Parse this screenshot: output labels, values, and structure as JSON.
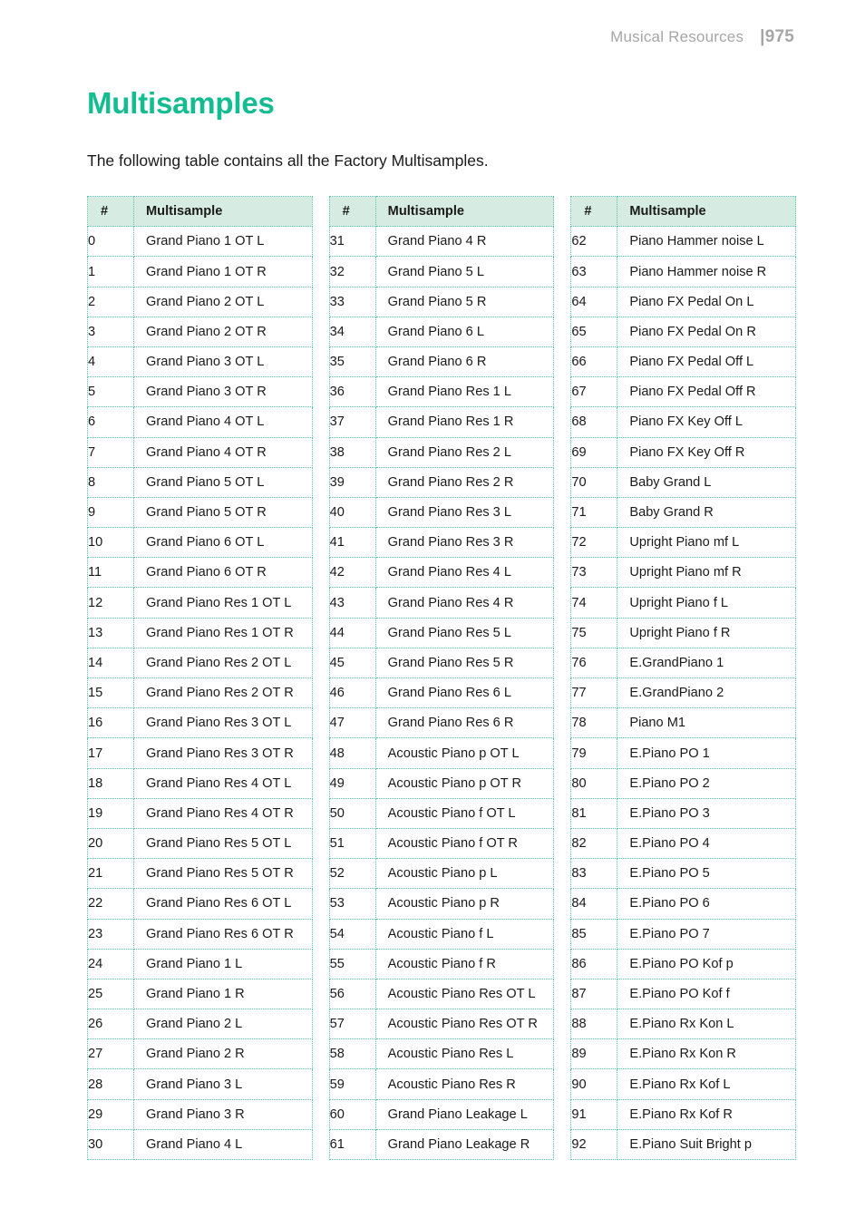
{
  "header": {
    "section_title": "Musical Resources",
    "page_number": "|975"
  },
  "page": {
    "title": "Multisamples",
    "intro": "The following table contains all the Factory Multisamples.",
    "accent_color": "#13bc91",
    "header_row_color": "#d6ece3",
    "grid_color": "#57c4ac"
  },
  "table": {
    "columns": [
      {
        "num_header": "#",
        "name_header": "Multisample"
      },
      {
        "num_header": "#",
        "name_header": "Multisample"
      },
      {
        "num_header": "#",
        "name_header": "Multisample"
      }
    ],
    "blocks": [
      {
        "rows": [
          {
            "num": "0",
            "name": "Grand Piano 1 OT L"
          },
          {
            "num": "1",
            "name": "Grand Piano 1 OT R"
          },
          {
            "num": "2",
            "name": "Grand Piano 2 OT L"
          },
          {
            "num": "3",
            "name": "Grand Piano 2 OT R"
          },
          {
            "num": "4",
            "name": "Grand Piano 3 OT L"
          },
          {
            "num": "5",
            "name": "Grand Piano 3 OT R"
          },
          {
            "num": "6",
            "name": "Grand Piano 4 OT L"
          },
          {
            "num": "7",
            "name": "Grand Piano 4 OT R"
          },
          {
            "num": "8",
            "name": "Grand Piano 5 OT L"
          },
          {
            "num": "9",
            "name": "Grand Piano 5 OT R"
          },
          {
            "num": "10",
            "name": "Grand Piano 6 OT L"
          },
          {
            "num": "11",
            "name": "Grand Piano 6 OT R"
          },
          {
            "num": "12",
            "name": "Grand Piano Res 1 OT L"
          },
          {
            "num": "13",
            "name": "Grand Piano Res 1 OT R"
          },
          {
            "num": "14",
            "name": "Grand Piano Res 2 OT L"
          },
          {
            "num": "15",
            "name": "Grand Piano Res 2 OT R"
          },
          {
            "num": "16",
            "name": "Grand Piano Res 3 OT L"
          },
          {
            "num": "17",
            "name": "Grand Piano Res 3 OT R"
          },
          {
            "num": "18",
            "name": "Grand Piano Res 4 OT L"
          },
          {
            "num": "19",
            "name": "Grand Piano Res 4 OT R"
          },
          {
            "num": "20",
            "name": "Grand Piano Res 5 OT L"
          },
          {
            "num": "21",
            "name": "Grand Piano Res 5 OT R"
          },
          {
            "num": "22",
            "name": "Grand Piano Res 6 OT L"
          },
          {
            "num": "23",
            "name": "Grand Piano Res 6 OT R"
          },
          {
            "num": "24",
            "name": "Grand Piano 1 L"
          },
          {
            "num": "25",
            "name": "Grand Piano 1 R"
          },
          {
            "num": "26",
            "name": "Grand Piano 2 L"
          },
          {
            "num": "27",
            "name": "Grand Piano 2 R"
          },
          {
            "num": "28",
            "name": "Grand Piano 3 L"
          },
          {
            "num": "29",
            "name": "Grand Piano 3 R"
          },
          {
            "num": "30",
            "name": "Grand Piano 4 L"
          }
        ]
      },
      {
        "rows": [
          {
            "num": "31",
            "name": "Grand Piano 4 R"
          },
          {
            "num": "32",
            "name": "Grand Piano 5 L"
          },
          {
            "num": "33",
            "name": "Grand Piano 5 R"
          },
          {
            "num": "34",
            "name": "Grand Piano 6 L"
          },
          {
            "num": "35",
            "name": "Grand Piano 6 R"
          },
          {
            "num": "36",
            "name": "Grand Piano Res 1 L"
          },
          {
            "num": "37",
            "name": "Grand Piano Res 1 R"
          },
          {
            "num": "38",
            "name": "Grand Piano Res 2 L"
          },
          {
            "num": "39",
            "name": "Grand Piano Res 2 R"
          },
          {
            "num": "40",
            "name": "Grand Piano Res 3 L"
          },
          {
            "num": "41",
            "name": "Grand Piano Res 3 R"
          },
          {
            "num": "42",
            "name": "Grand Piano Res 4 L"
          },
          {
            "num": "43",
            "name": "Grand Piano Res 4 R"
          },
          {
            "num": "44",
            "name": "Grand Piano Res 5 L"
          },
          {
            "num": "45",
            "name": "Grand Piano Res 5 R"
          },
          {
            "num": "46",
            "name": "Grand Piano Res 6 L"
          },
          {
            "num": "47",
            "name": "Grand Piano Res 6 R"
          },
          {
            "num": "48",
            "name": "Acoustic Piano p OT L"
          },
          {
            "num": "49",
            "name": "Acoustic Piano p OT R"
          },
          {
            "num": "50",
            "name": "Acoustic Piano f OT L"
          },
          {
            "num": "51",
            "name": "Acoustic Piano f OT R"
          },
          {
            "num": "52",
            "name": "Acoustic Piano p L"
          },
          {
            "num": "53",
            "name": "Acoustic Piano p R"
          },
          {
            "num": "54",
            "name": "Acoustic Piano f L"
          },
          {
            "num": "55",
            "name": "Acoustic Piano f R"
          },
          {
            "num": "56",
            "name": "Acoustic Piano Res OT L"
          },
          {
            "num": "57",
            "name": "Acoustic Piano Res OT R"
          },
          {
            "num": "58",
            "name": "Acoustic Piano Res L"
          },
          {
            "num": "59",
            "name": "Acoustic Piano Res R"
          },
          {
            "num": "60",
            "name": "Grand Piano Leakage L"
          },
          {
            "num": "61",
            "name": "Grand Piano Leakage R"
          }
        ]
      },
      {
        "rows": [
          {
            "num": "62",
            "name": "Piano Hammer noise L"
          },
          {
            "num": "63",
            "name": "Piano Hammer noise R"
          },
          {
            "num": "64",
            "name": "Piano FX Pedal On L"
          },
          {
            "num": "65",
            "name": "Piano FX Pedal On R"
          },
          {
            "num": "66",
            "name": "Piano FX Pedal Off L"
          },
          {
            "num": "67",
            "name": "Piano FX Pedal Off R"
          },
          {
            "num": "68",
            "name": "Piano FX Key Off L"
          },
          {
            "num": "69",
            "name": "Piano FX Key Off R"
          },
          {
            "num": "70",
            "name": "Baby Grand L"
          },
          {
            "num": "71",
            "name": "Baby Grand R"
          },
          {
            "num": "72",
            "name": "Upright Piano mf L"
          },
          {
            "num": "73",
            "name": "Upright Piano mf R"
          },
          {
            "num": "74",
            "name": "Upright Piano f L"
          },
          {
            "num": "75",
            "name": "Upright Piano f R"
          },
          {
            "num": "76",
            "name": "E.GrandPiano 1"
          },
          {
            "num": "77",
            "name": "E.GrandPiano 2"
          },
          {
            "num": "78",
            "name": "Piano M1"
          },
          {
            "num": "79",
            "name": "E.Piano PO 1"
          },
          {
            "num": "80",
            "name": "E.Piano PO 2"
          },
          {
            "num": "81",
            "name": "E.Piano PO 3"
          },
          {
            "num": "82",
            "name": "E.Piano PO 4"
          },
          {
            "num": "83",
            "name": "E.Piano PO 5"
          },
          {
            "num": "84",
            "name": "E.Piano PO 6"
          },
          {
            "num": "85",
            "name": "E.Piano PO 7"
          },
          {
            "num": "86",
            "name": "E.Piano PO Kof p"
          },
          {
            "num": "87",
            "name": "E.Piano PO Kof f"
          },
          {
            "num": "88",
            "name": "E.Piano Rx Kon L"
          },
          {
            "num": "89",
            "name": "E.Piano Rx Kon R"
          },
          {
            "num": "90",
            "name": "E.Piano Rx Kof L"
          },
          {
            "num": "91",
            "name": "E.Piano Rx Kof R"
          },
          {
            "num": "92",
            "name": "E.Piano Suit Bright p"
          }
        ]
      }
    ]
  }
}
